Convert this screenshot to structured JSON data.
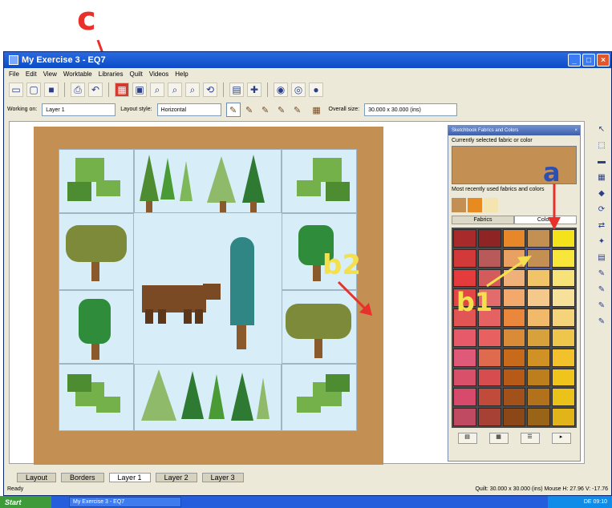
{
  "callouts": {
    "a": "a",
    "b1": "b1",
    "b2": "b2",
    "c": "c"
  },
  "window": {
    "title": "My Exercise 3 - EQ7",
    "menu": [
      "File",
      "Edit",
      "View",
      "Worktable",
      "Libraries",
      "Quilt",
      "Videos",
      "Help"
    ]
  },
  "toolbar2": {
    "working_on_label": "Working on:",
    "working_on_value": "Layer 1",
    "layout_style_label": "Layout style:",
    "layout_style_value": "Horizontal",
    "overall_size_label": "Overall size:",
    "overall_size_value": "30.000 x 30.000 (ins)"
  },
  "palette": {
    "title": "Sketchbook Fabrics and Colors",
    "current_label": "Currently selected fabric or color",
    "recent_label": "Most recently used fabrics and colors",
    "tabs": [
      "Fabrics",
      "Colors"
    ],
    "active_tab": "Colors",
    "current_color": "#c48f53",
    "recent_colors": [
      "#c48f53",
      "#e78a1f",
      "#f4e4b0"
    ],
    "swatches": [
      "#a82a2a",
      "#8e2424",
      "#e8862a",
      "#c48f53",
      "#f4e21a",
      "#d23a3a",
      "#b85a5a",
      "#e9a063",
      "#c48f53",
      "#f8e63b",
      "#e43c3c",
      "#d45b5b",
      "#f0b07a",
      "#f2c46a",
      "#f6e278",
      "#e44646",
      "#e46b6b",
      "#f2a96b",
      "#f4c98b",
      "#f6e09a",
      "#e25555",
      "#e46262",
      "#e9883d",
      "#f0ba6a",
      "#f4d37a",
      "#e65a6a",
      "#e86060",
      "#d98b38",
      "#d7a13b",
      "#f0c54b",
      "#df5a78",
      "#e06a4e",
      "#c86a1c",
      "#d19225",
      "#f2c12c",
      "#d9506b",
      "#d74d4f",
      "#b85a17",
      "#bd7e1d",
      "#f0c51b",
      "#d84a6c",
      "#c14b3b",
      "#a3511a",
      "#b2711b",
      "#eac21a",
      "#c04a62",
      "#a74035",
      "#8b4716",
      "#9a6418",
      "#e3b419"
    ],
    "footer": [
      "",
      "",
      "",
      ""
    ]
  },
  "bottom_tabs": [
    "Layout",
    "Borders",
    "Layer 1",
    "Layer 2",
    "Layer 3"
  ],
  "active_bottom_tab": "Layer 1",
  "status": {
    "left": "Ready",
    "right": "Quilt: 30.000 x 30.000 (ins)    Mouse  H: 27.96  V: -17.76"
  },
  "taskbar": {
    "start": "Start",
    "task": "My Exercise 3 - EQ7",
    "tray": "DE  09:10"
  }
}
